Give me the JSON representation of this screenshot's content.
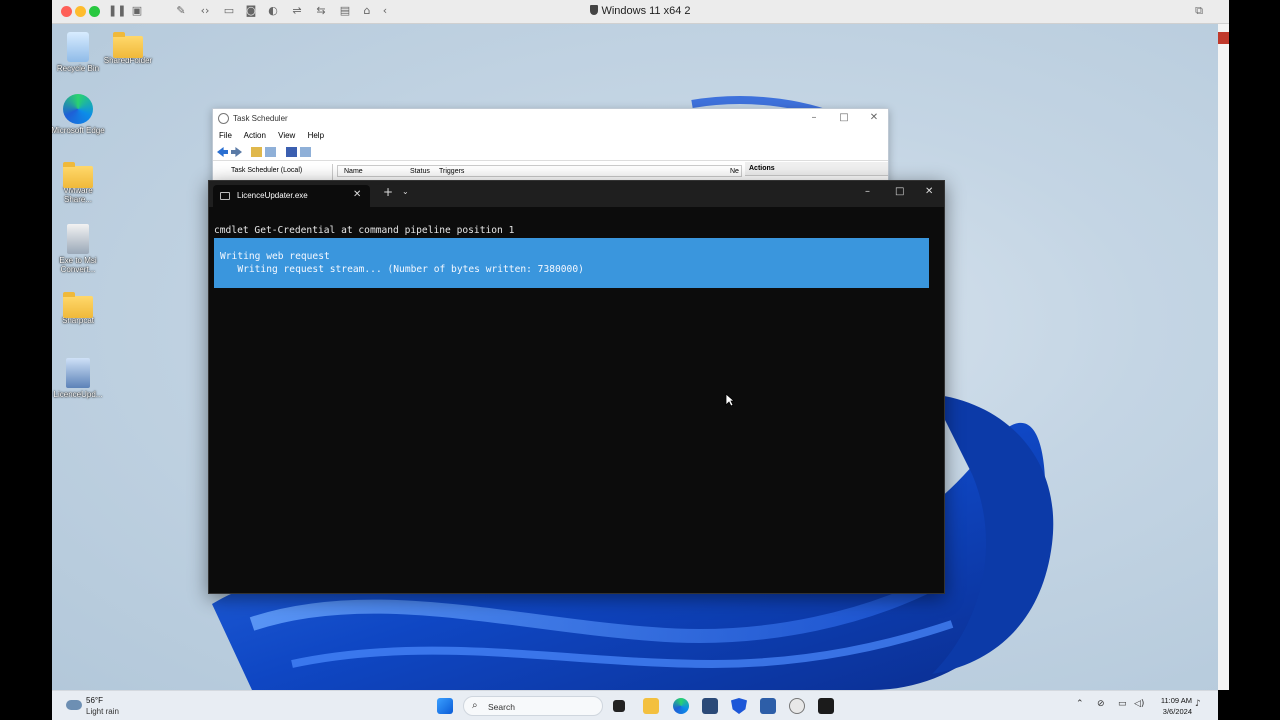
{
  "vm": {
    "title": "Windows 11 x64 2"
  },
  "desktop": {
    "icons": [
      {
        "label": "Recycle Bin"
      },
      {
        "label": "SharedFolder"
      },
      {
        "label": "Microsoft Edge"
      },
      {
        "label": "VMware Share..."
      },
      {
        "label": "Exe to Msi Convert..."
      },
      {
        "label": "Sharpcat"
      },
      {
        "label": "LicenceUpd..."
      }
    ]
  },
  "task_scheduler": {
    "title": "Task Scheduler",
    "menu": [
      "File",
      "Action",
      "View",
      "Help"
    ],
    "tree_item": "Task Scheduler (Local)",
    "columns": [
      "Name",
      "Status",
      "Triggers",
      "Ne"
    ],
    "actions_header": "Actions"
  },
  "terminal": {
    "tab_title": "LicenceUpdater.exe",
    "line1": "cmdlet Get-Credential at command pipeline position 1",
    "progress_activity": "Writing web request",
    "progress_status": "   Writing request stream... (Number of bytes written: 7380000)"
  },
  "taskbar": {
    "weather_temp": "56°F",
    "weather_desc": "Light rain",
    "search_placeholder": "Search",
    "time": "11:09 AM",
    "date": "3/6/2024"
  }
}
